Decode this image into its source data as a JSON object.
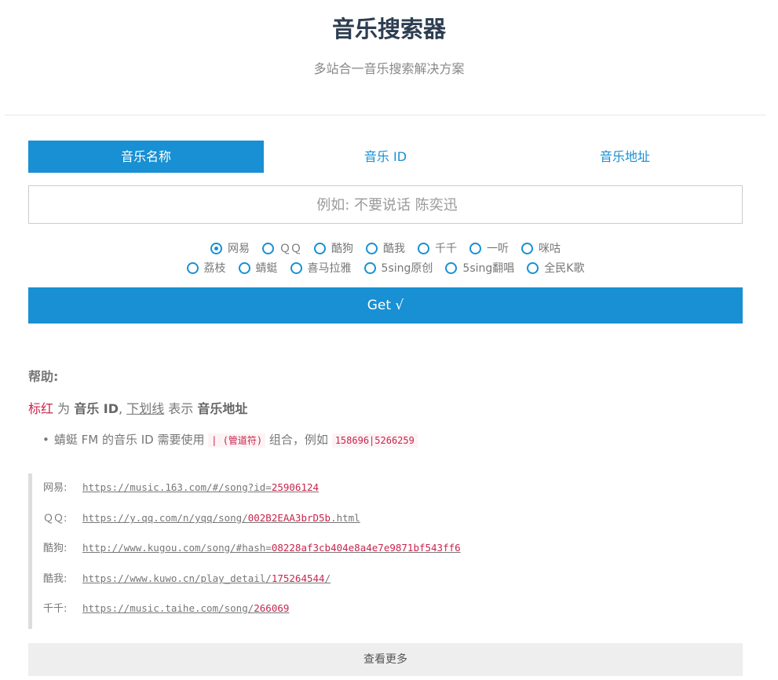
{
  "header": {
    "title": "音乐搜索器",
    "subtitle": "多站合一音乐搜索解决方案"
  },
  "tabs": [
    {
      "label": "音乐名称",
      "active": true
    },
    {
      "label": "音乐 ID",
      "active": false
    },
    {
      "label": "音乐地址",
      "active": false
    }
  ],
  "search": {
    "placeholder": "例如: 不要说话 陈奕迅",
    "value": ""
  },
  "sites_row1": [
    {
      "label": "网易",
      "checked": true
    },
    {
      "label": "ＱＱ",
      "checked": false
    },
    {
      "label": "酷狗",
      "checked": false
    },
    {
      "label": "酷我",
      "checked": false
    },
    {
      "label": "千千",
      "checked": false
    },
    {
      "label": "一听",
      "checked": false
    },
    {
      "label": "咪咕",
      "checked": false
    }
  ],
  "sites_row2": [
    {
      "label": "荔枝",
      "checked": false
    },
    {
      "label": "蜻蜓",
      "checked": false
    },
    {
      "label": "喜马拉雅",
      "checked": false
    },
    {
      "label": "5sing原创",
      "checked": false
    },
    {
      "label": "5sing翻唱",
      "checked": false
    },
    {
      "label": "全民K歌",
      "checked": false
    }
  ],
  "get_button": "Get √",
  "help": {
    "title": "帮助:",
    "legend": {
      "red": "标红",
      "w1": " 为 ",
      "b1": "音乐 ID",
      "w2": ", ",
      "ul": "下划线",
      "w3": " 表示 ",
      "b2": "音乐地址"
    },
    "note": {
      "text1": "蜻蜓 FM 的音乐 ID 需要使用 ",
      "code1": "| (管道符)",
      "text2": " 组合，例如 ",
      "code2": "158696|5266259"
    }
  },
  "examples": [
    {
      "label": "网易:",
      "prefix": "https://music.163.com/#/song?id=",
      "id": "25906124",
      "suffix": ""
    },
    {
      "label": "ＱＱ:",
      "prefix": "https://y.qq.com/n/yqq/song/",
      "id": "002B2EAA3brD5b",
      "suffix": ".html"
    },
    {
      "label": "酷狗:",
      "prefix": "http://www.kugou.com/song/#hash=",
      "id": "08228af3cb404e8a4e7e9871bf543ff6",
      "suffix": ""
    },
    {
      "label": "酷我:",
      "prefix": "https://www.kuwo.cn/play_detail/",
      "id": "175264544",
      "suffix": "/"
    },
    {
      "label": "千千:",
      "prefix": "https://music.taihe.com/song/",
      "id": "266069",
      "suffix": ""
    }
  ],
  "more_button": "查看更多",
  "colors": {
    "accent": "#1890d3",
    "id_red": "#c7254e"
  }
}
